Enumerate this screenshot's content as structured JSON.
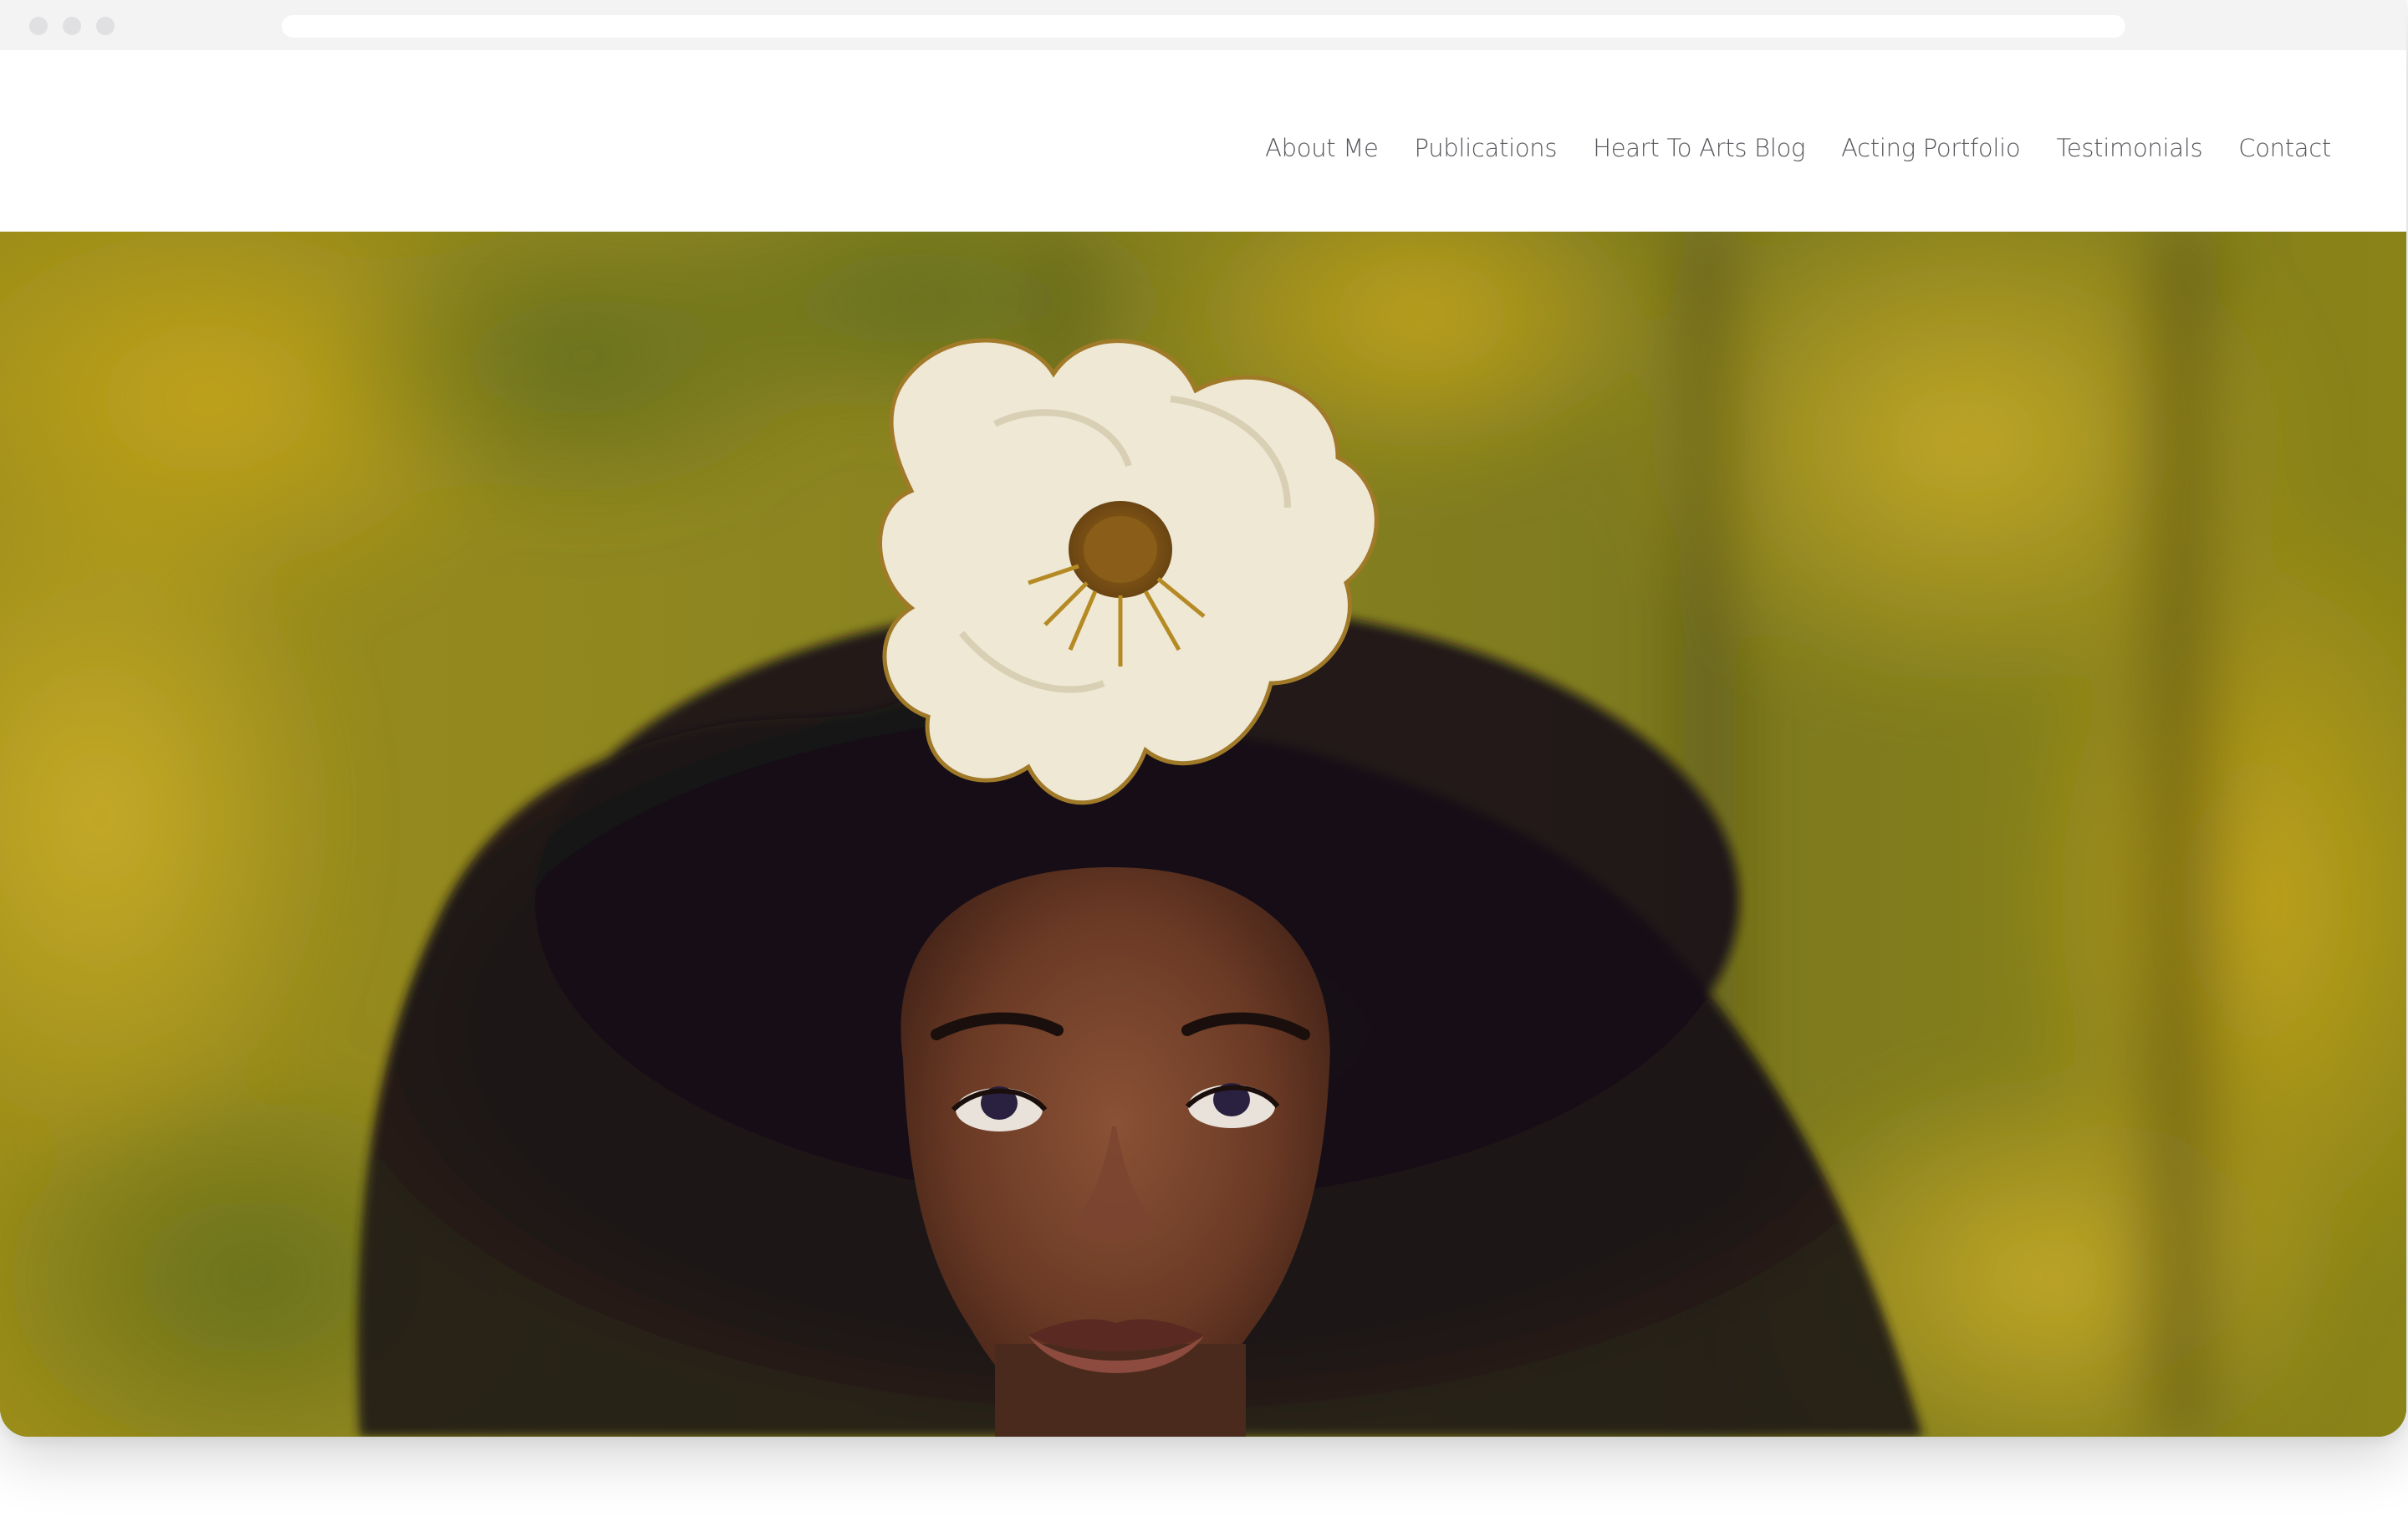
{
  "browser": {
    "window_controls": [
      "close-dot",
      "minimize-dot",
      "maximize-dot"
    ],
    "url": ""
  },
  "nav": {
    "items": [
      {
        "label": "About Me"
      },
      {
        "label": "Publications"
      },
      {
        "label": "Heart To Arts Blog"
      },
      {
        "label": "Acting Portfolio"
      },
      {
        "label": "Testimonials"
      },
      {
        "label": "Contact"
      }
    ]
  },
  "hero": {
    "image": "portrait of a woman with voluminous natural hair and a white flower on her head, looking upward, autumn foliage background"
  },
  "colors": {
    "nav_text": "#56565c",
    "background": "#ffffff",
    "chrome": "#f3f3f4"
  }
}
